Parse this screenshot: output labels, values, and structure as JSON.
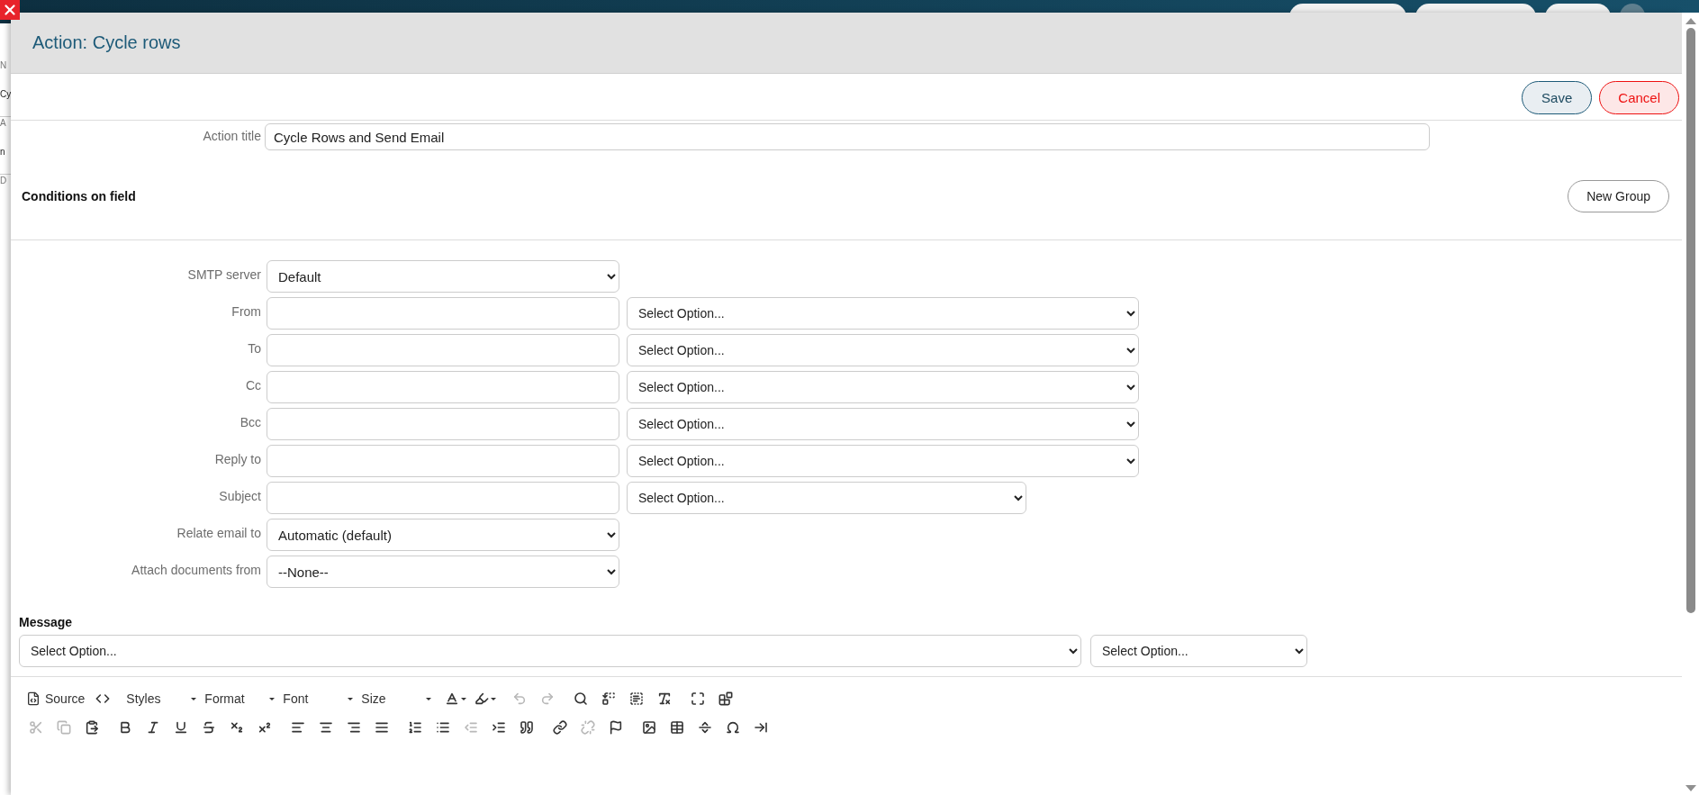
{
  "background": {
    "side_labels": [
      "N",
      "Cy",
      "A",
      "n",
      "D"
    ]
  },
  "dialog": {
    "title": "Action: Cycle rows",
    "buttons": [
      {
        "label": "Save",
        "kind": "primary"
      },
      {
        "label": "Cancel",
        "kind": "danger"
      }
    ]
  },
  "action_title": {
    "label": "Action title",
    "value": "Cycle Rows and Send Email"
  },
  "conditions": {
    "heading": "Conditions on field",
    "button": "New Group"
  },
  "email_fields": [
    {
      "label": "SMTP server",
      "kind": "select",
      "value": "Default"
    },
    {
      "label": "From",
      "kind": "pair",
      "select": "Select Option..."
    },
    {
      "label": "To",
      "kind": "pair",
      "select": "Select Option..."
    },
    {
      "label": "Cc",
      "kind": "pair",
      "select": "Select Option..."
    },
    {
      "label": "Bcc",
      "kind": "pair",
      "select": "Select Option..."
    },
    {
      "label": "Reply to",
      "kind": "pair",
      "select": "Select Option..."
    },
    {
      "label": "Subject",
      "kind": "pairshort",
      "select": "Select Option..."
    },
    {
      "label": "Relate email to",
      "kind": "select",
      "value": "Automatic (default)"
    },
    {
      "label": "Attach documents from",
      "kind": "select",
      "value": "--None--"
    }
  ],
  "message": {
    "heading": "Message",
    "selects": [
      "Select Option...",
      "Select Option..."
    ]
  },
  "editor": {
    "toolbar_rows": [
      [
        [
          {
            "kind": "labeled",
            "label": "Source",
            "disabled": false
          },
          {
            "kind": "icon",
            "disabled": false
          }
        ],
        [
          {
            "kind": "dropdown",
            "label": "Styles"
          },
          {
            "kind": "dropdown",
            "label": "Format"
          },
          {
            "kind": "dropdown",
            "label": "Font"
          },
          {
            "kind": "dropdown",
            "label": "Size"
          }
        ],
        [
          {
            "kind": "color",
            "disabled": false
          },
          {
            "kind": "color",
            "disabled": false
          }
        ],
        [
          {
            "kind": "icon",
            "disabled": true
          },
          {
            "kind": "icon",
            "disabled": true
          }
        ],
        [
          {
            "kind": "icon",
            "disabled": false
          },
          {
            "kind": "icon",
            "disabled": false
          },
          {
            "kind": "icon",
            "disabled": false
          },
          {
            "kind": "icon",
            "disabled": false
          }
        ],
        [
          {
            "kind": "icon",
            "disabled": false
          },
          {
            "kind": "icon",
            "disabled": false
          }
        ]
      ],
      [
        [
          {
            "kind": "icon",
            "disabled": true
          },
          {
            "kind": "icon",
            "disabled": true
          },
          {
            "kind": "icon",
            "disabled": false
          }
        ],
        [
          {
            "kind": "icon",
            "disabled": false
          },
          {
            "kind": "icon",
            "disabled": false
          },
          {
            "kind": "icon",
            "disabled": false
          },
          {
            "kind": "icon",
            "disabled": false
          },
          {
            "kind": "icon",
            "disabled": false
          },
          {
            "kind": "icon",
            "disabled": false
          }
        ],
        [
          {
            "kind": "icon",
            "disabled": false
          },
          {
            "kind": "icon",
            "disabled": false
          },
          {
            "kind": "icon",
            "disabled": false
          },
          {
            "kind": "icon",
            "disabled": false
          }
        ],
        [
          {
            "kind": "icon",
            "disabled": false
          },
          {
            "kind": "icon",
            "disabled": false
          },
          {
            "kind": "icon",
            "disabled": true
          },
          {
            "kind": "icon",
            "disabled": false
          },
          {
            "kind": "icon",
            "disabled": false
          }
        ],
        [
          {
            "kind": "icon",
            "disabled": false
          },
          {
            "kind": "icon",
            "disabled": true
          },
          {
            "kind": "icon",
            "disabled": false
          }
        ],
        [
          {
            "kind": "icon",
            "disabled": false
          },
          {
            "kind": "icon",
            "disabled": false
          },
          {
            "kind": "icon",
            "disabled": false
          },
          {
            "kind": "icon",
            "disabled": false
          },
          {
            "kind": "icon",
            "disabled": false
          }
        ]
      ]
    ]
  }
}
